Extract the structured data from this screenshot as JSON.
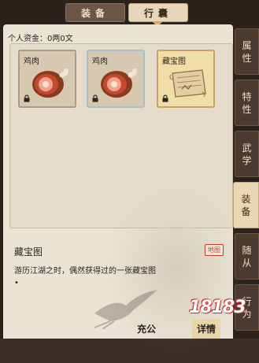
{
  "top_tabs": [
    {
      "label": "装备",
      "active": false
    },
    {
      "label": "行囊",
      "active": true
    }
  ],
  "funds_text": "个人资金：0两0文",
  "slots": [
    {
      "name": "鸡肉",
      "icon": "ham-icon",
      "locked": true
    },
    {
      "name": "鸡肉",
      "icon": "ham-icon",
      "locked": true
    },
    {
      "name": "藏宝图",
      "icon": "treasure-map-icon",
      "locked": true
    }
  ],
  "detail": {
    "title": "藏宝图",
    "badge": "地图",
    "description": "游历江湖之时，偶然获得过的一张藏宝图",
    "extra": "•"
  },
  "buttons": {
    "stash": "充公",
    "detail": "详情"
  },
  "side_tabs": [
    {
      "label": "属性",
      "active": false
    },
    {
      "label": "特性",
      "active": false
    },
    {
      "label": "武学",
      "active": false
    },
    {
      "label": "装备",
      "active": true
    },
    {
      "label": "随从",
      "active": false
    },
    {
      "label": "行为",
      "active": false
    }
  ],
  "watermark": "18183",
  "colors": {
    "panel_bg": "#ebe3d4",
    "accent_gold": "#f1dda8",
    "badge_red": "#c43a2b"
  }
}
